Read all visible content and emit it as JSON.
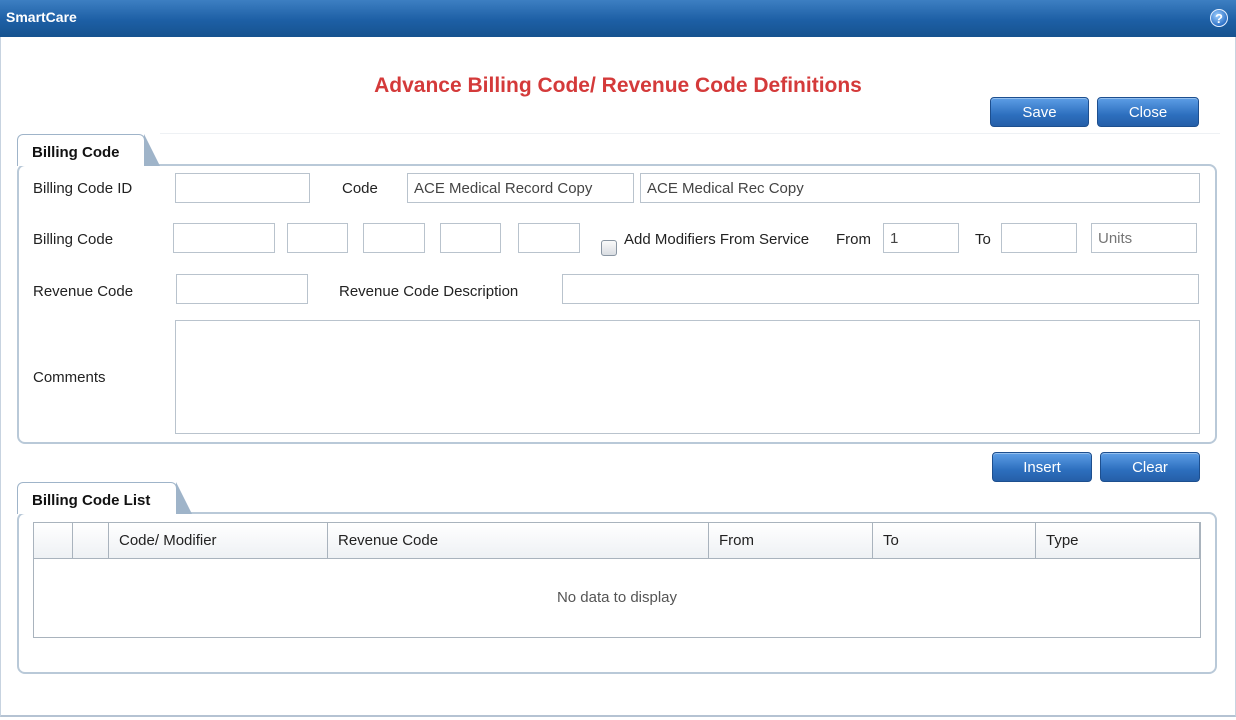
{
  "window": {
    "app_title": "SmartCare",
    "help_icon": "?"
  },
  "page_title": "Advance Billing Code/ Revenue Code Definitions",
  "toolbar": {
    "save_label": "Save",
    "close_label": "Close"
  },
  "billing_code_section": {
    "tab_label": "Billing Code",
    "billing_code_id_label": "Billing Code ID",
    "billing_code_id_value": "",
    "code_label": "Code",
    "code_value": "ACE Medical Record Copy",
    "code_description_value": "ACE Medical Rec Copy",
    "billing_code_label": "Billing Code",
    "billing_code_values": [
      "",
      "",
      "",
      "",
      ""
    ],
    "add_modifiers_label": "Add Modifiers From Service",
    "add_modifiers_checked": false,
    "from_label": "From",
    "from_value": "1",
    "to_label": "To",
    "to_value": "",
    "units_placeholder": "Units",
    "revenue_code_label": "Revenue Code",
    "revenue_code_value": "",
    "revenue_code_description_label": "Revenue Code Description",
    "revenue_code_description_value": "",
    "comments_label": "Comments",
    "comments_value": ""
  },
  "list_actions": {
    "insert_label": "Insert",
    "clear_label": "Clear"
  },
  "billing_code_list": {
    "tab_label": "Billing Code List",
    "columns": [
      "",
      "",
      "Code/ Modifier",
      "Revenue Code",
      "From",
      "To",
      "Type"
    ],
    "empty_message": "No data to display"
  },
  "colors": {
    "title_red": "#d43a3a",
    "titlebar_blue": "#1d5fa5",
    "button_blue": "#2d6fbe"
  }
}
